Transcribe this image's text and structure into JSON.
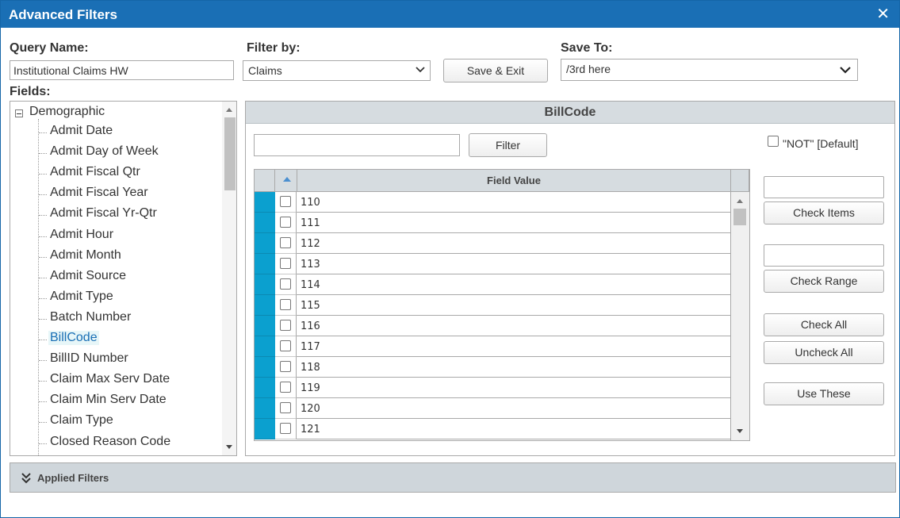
{
  "dialog": {
    "title": "Advanced Filters"
  },
  "labels": {
    "query_name": "Query Name:",
    "filter_by": "Filter by:",
    "save_to": "Save To:",
    "fields": "Fields:"
  },
  "query_name": {
    "value": "Institutional Claims HW"
  },
  "filter_by": {
    "selected": "Claims"
  },
  "save_to": {
    "selected": "/3rd here"
  },
  "buttons": {
    "save_exit": "Save & Exit",
    "filter": "Filter",
    "check_items": "Check Items",
    "check_range": "Check Range",
    "check_all": "Check All",
    "uncheck_all": "Uncheck All",
    "use_these": "Use These"
  },
  "tree": {
    "root": "Demographic",
    "items": [
      "Admit Date",
      "Admit Day of Week",
      "Admit Fiscal Qtr",
      "Admit Fiscal Year",
      "Admit Fiscal Yr-Qtr",
      "Admit Hour",
      "Admit Month",
      "Admit Source",
      "Admit Type",
      "Batch Number",
      "BillCode",
      "BillID Number",
      "Claim Max Serv Date",
      "Claim Min Serv Date",
      "Claim Type",
      "Closed Reason Code"
    ],
    "selected": "BillCode"
  },
  "panel": {
    "title": "BillCode",
    "not_label": "\"NOT\" [Default]",
    "grid_header": "Field Value",
    "rows": [
      "110",
      "111",
      "112",
      "113",
      "114",
      "115",
      "116",
      "117",
      "118",
      "119",
      "120",
      "121"
    ]
  },
  "applied_filters": {
    "label": "Applied Filters"
  },
  "colors": {
    "titlebar": "#1a6fb5",
    "row_marker": "#0ba0cf",
    "header_bg": "#d6dce0",
    "selected_bg": "#e7f6f8"
  }
}
